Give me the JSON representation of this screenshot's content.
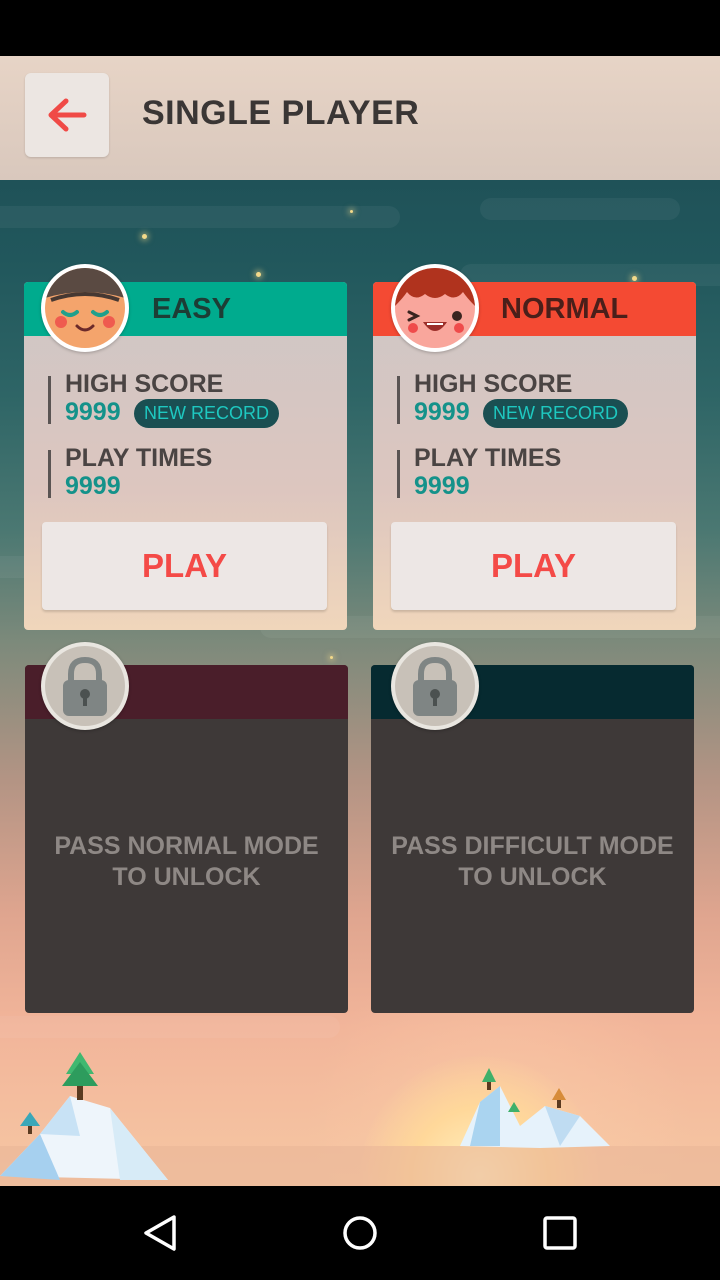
{
  "header": {
    "title": "SINGLE PLAYER",
    "back_icon": "arrow-left-icon"
  },
  "colors": {
    "accent_red": "#f44a47",
    "easy_green": "#00ab8e",
    "normal_red": "#f44a33",
    "score_teal": "#14928a"
  },
  "cards": [
    {
      "title": "EASY",
      "high_score_label": "HIGH SCORE",
      "high_score": "9999",
      "badge": "NEW  RECORD",
      "play_times_label": "PLAY TIMES",
      "play_times": "9999",
      "play_label": "PLAY"
    },
    {
      "title": "NORMAL",
      "high_score_label": "HIGH SCORE",
      "high_score": "9999",
      "badge": "NEW  RECORD",
      "play_times_label": "PLAY TIMES",
      "play_times": "9999",
      "play_label": "PLAY"
    }
  ],
  "locked": [
    {
      "text": "PASS NORMAL MODE\nTO UNLOCK",
      "icon": "lock-icon"
    },
    {
      "text": "PASS DIFFICULT MODE\nTO UNLOCK",
      "icon": "lock-icon"
    }
  ],
  "nav": {
    "back": "back-triangle-icon",
    "home": "home-circle-icon",
    "recents": "recents-square-icon"
  }
}
